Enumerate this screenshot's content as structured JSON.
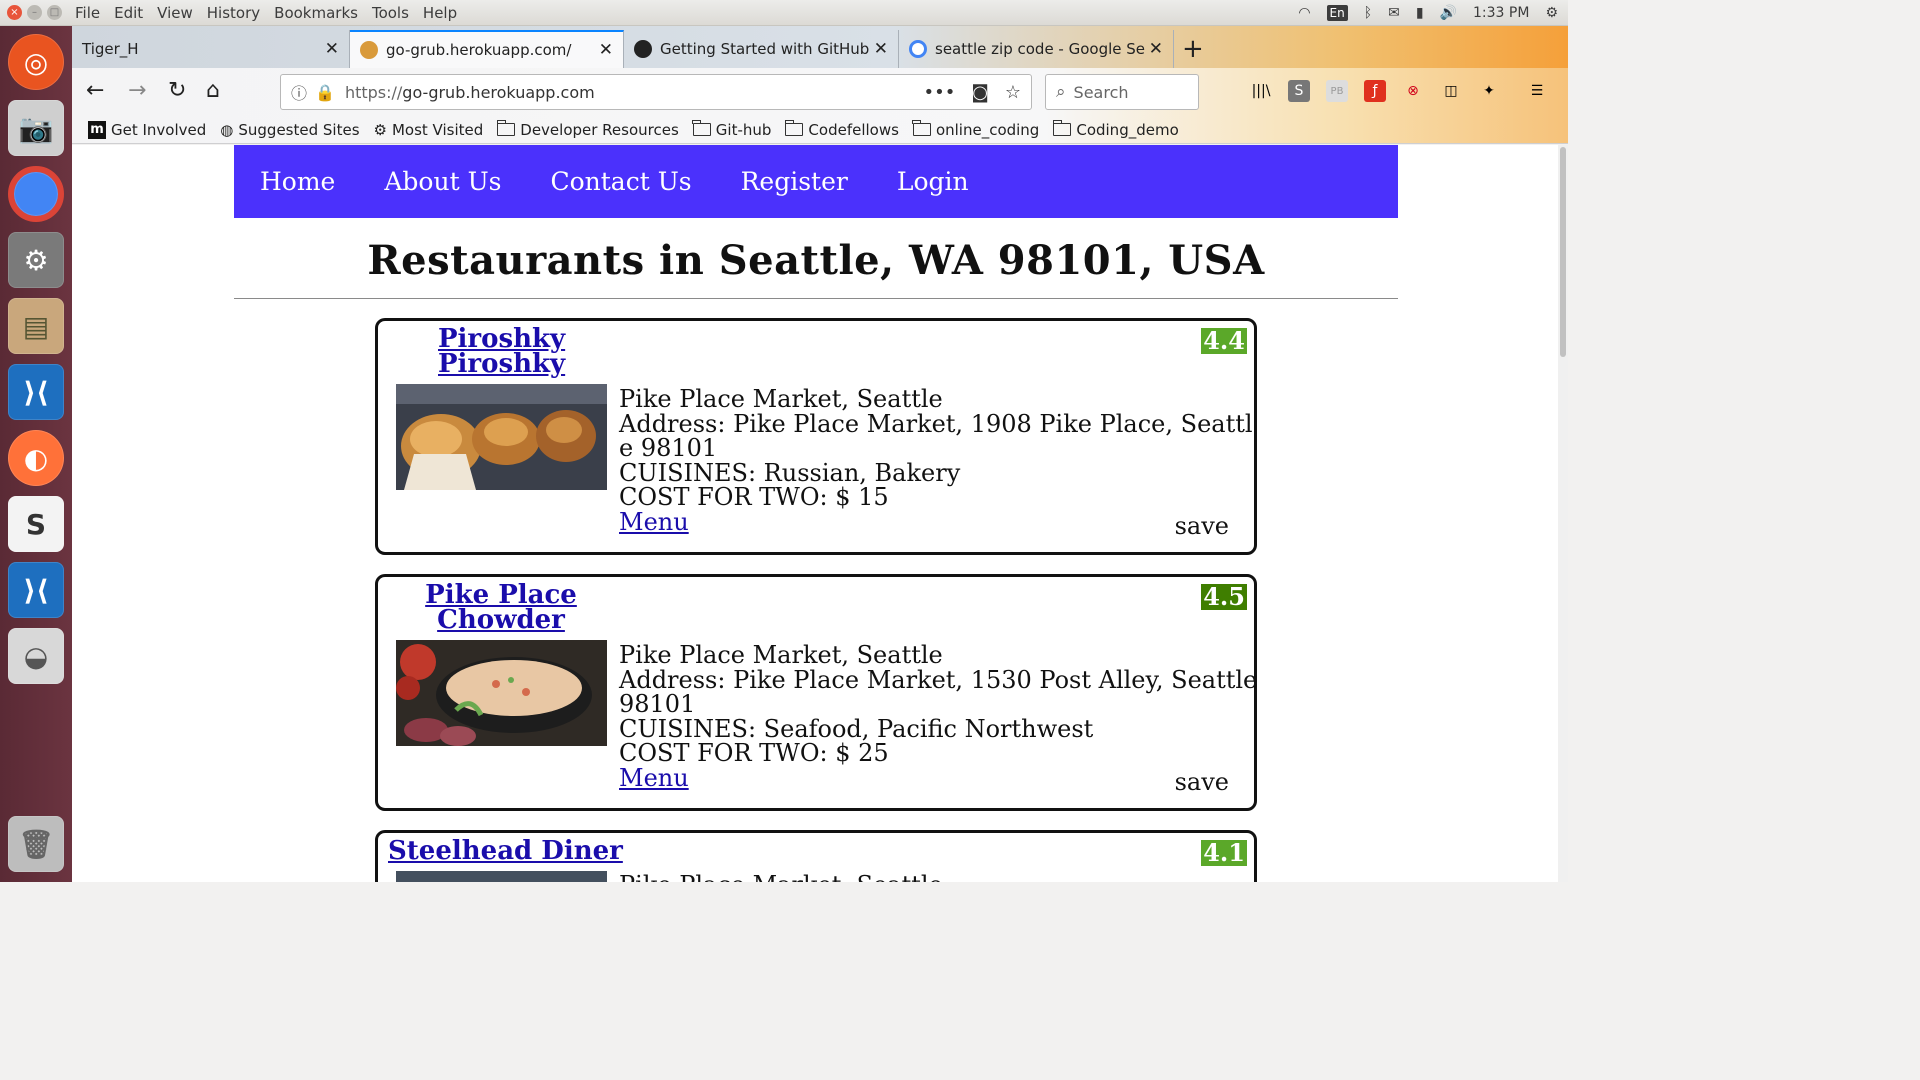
{
  "os": {
    "menu": [
      "File",
      "Edit",
      "View",
      "History",
      "Bookmarks",
      "Tools",
      "Help"
    ],
    "tray": {
      "lang": "En",
      "time": "1:33 PM"
    }
  },
  "browser": {
    "tabs": [
      {
        "title": "Tiger_H"
      },
      {
        "title": "go-grub.herokuapp.com/"
      },
      {
        "title": "Getting Started with GitHub"
      },
      {
        "title": "seattle zip code - Google Se"
      }
    ],
    "url_proto": "https://",
    "url_host": "go-grub.herokuapp.com",
    "search_placeholder": "Search",
    "bookmarks": [
      "Get Involved",
      "Suggested Sites",
      "Most Visited",
      "Developer Resources",
      "Git-hub",
      "Codefellows",
      "online_coding",
      "Coding_demo"
    ]
  },
  "site": {
    "nav": [
      "Home",
      "About Us",
      "Contact Us",
      "Register",
      "Login"
    ],
    "heading": "Restaurants in Seattle, WA 98101, USA",
    "save_label": "save",
    "menu_label": "Menu",
    "restaurants": [
      {
        "name": "Piroshky Piroshky",
        "rating": "4.4",
        "rating_color": "#5ba829",
        "locality": "Pike Place Market, Seattle",
        "address": "Address: Pike Place Market, 1908 Pike Place, Seattle 98101",
        "cuisines": "CUISINES: Russian, Bakery",
        "cost": "COST FOR TWO: $ 15"
      },
      {
        "name": "Pike Place Chowder",
        "rating": "4.5",
        "rating_color": "#3f7e00",
        "locality": "Pike Place Market, Seattle",
        "address": "Address: Pike Place Market, 1530 Post Alley, Seattle 98101",
        "cuisines": "CUISINES: Seafood, Pacific Northwest",
        "cost": "COST FOR TWO: $ 25"
      },
      {
        "name": "Steelhead Diner",
        "rating": "4.1",
        "rating_color": "#5ba829",
        "locality": "Pike Place Market, Seattle"
      }
    ]
  }
}
